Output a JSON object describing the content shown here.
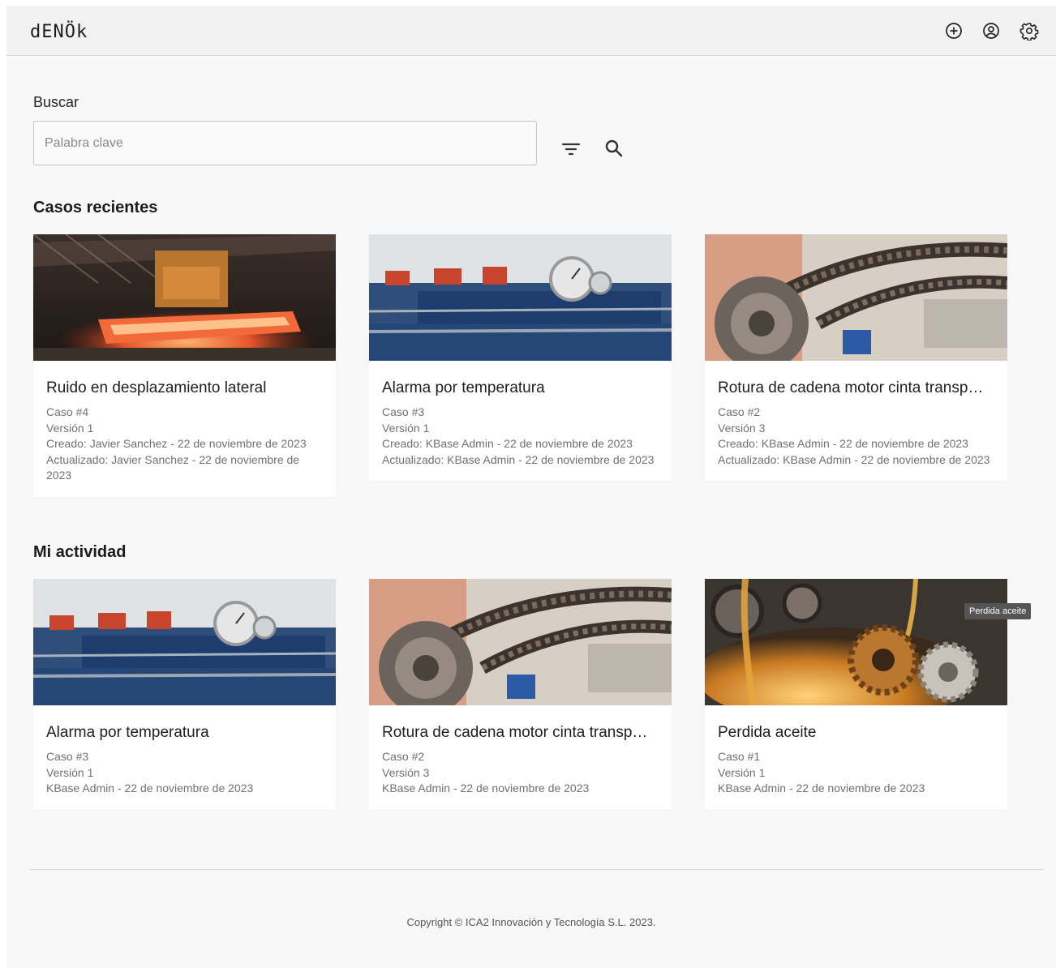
{
  "header": {
    "logo": "dENÖk",
    "icons": [
      "add-circle-icon",
      "account-circle-icon",
      "settings-gear-icon"
    ]
  },
  "search": {
    "label": "Buscar",
    "placeholder": "Palabra clave",
    "value": "",
    "icons": [
      "filter-icon",
      "search-icon"
    ]
  },
  "recent": {
    "title": "Casos recientes",
    "cards": [
      {
        "image": "steel-mill-crane-photo",
        "title": "Ruido en desplazamiento lateral",
        "caso": "Caso #4",
        "version": "Versión 1",
        "created": "Creado: Javier Sanchez - 22 de noviembre de 2023",
        "updated": "Actualizado: Javier Sanchez - 22 de noviembre de 2023"
      },
      {
        "image": "pressure-gauge-pipes-photo",
        "title": "Alarma por temperatura",
        "caso": "Caso #3",
        "version": "Versión 1",
        "created": "Creado: KBase Admin - 22 de noviembre de 2023",
        "updated": "Actualizado: KBase Admin - 22 de noviembre de 2023"
      },
      {
        "image": "chain-sprocket-motor-photo",
        "title": "Rotura de cadena motor cinta transp…",
        "caso": "Caso #2",
        "version": "Versión 3",
        "created": "Creado: KBase Admin - 22 de noviembre de 2023",
        "updated": "Actualizado: KBase Admin - 22 de noviembre de 2023"
      }
    ]
  },
  "activity": {
    "title": "Mi actividad",
    "cards": [
      {
        "image": "pressure-gauge-pipes-photo",
        "title": "Alarma por temperatura",
        "caso": "Caso #3",
        "version": "Versión 1",
        "line": "KBase Admin - 22 de noviembre de 2023"
      },
      {
        "image": "chain-sprocket-motor-photo",
        "title": "Rotura de cadena motor cinta transp…",
        "caso": "Caso #2",
        "version": "Versión 3",
        "line": "KBase Admin - 22 de noviembre de 2023"
      },
      {
        "image": "gears-oil-leak-photo",
        "title": "Perdida aceite",
        "caso": "Caso #1",
        "version": "Versión 1",
        "line": "KBase Admin - 22 de noviembre de 2023"
      }
    ],
    "tooltip": "Perdida aceite"
  },
  "footer": {
    "copyright": "Copyright © ICA2 Innovación y Tecnología S.L. 2023."
  },
  "colors": {
    "background": "#f8f8f8",
    "topbar": "#f2f2f2",
    "card": "#ffffff",
    "meta_text": "#707070"
  }
}
